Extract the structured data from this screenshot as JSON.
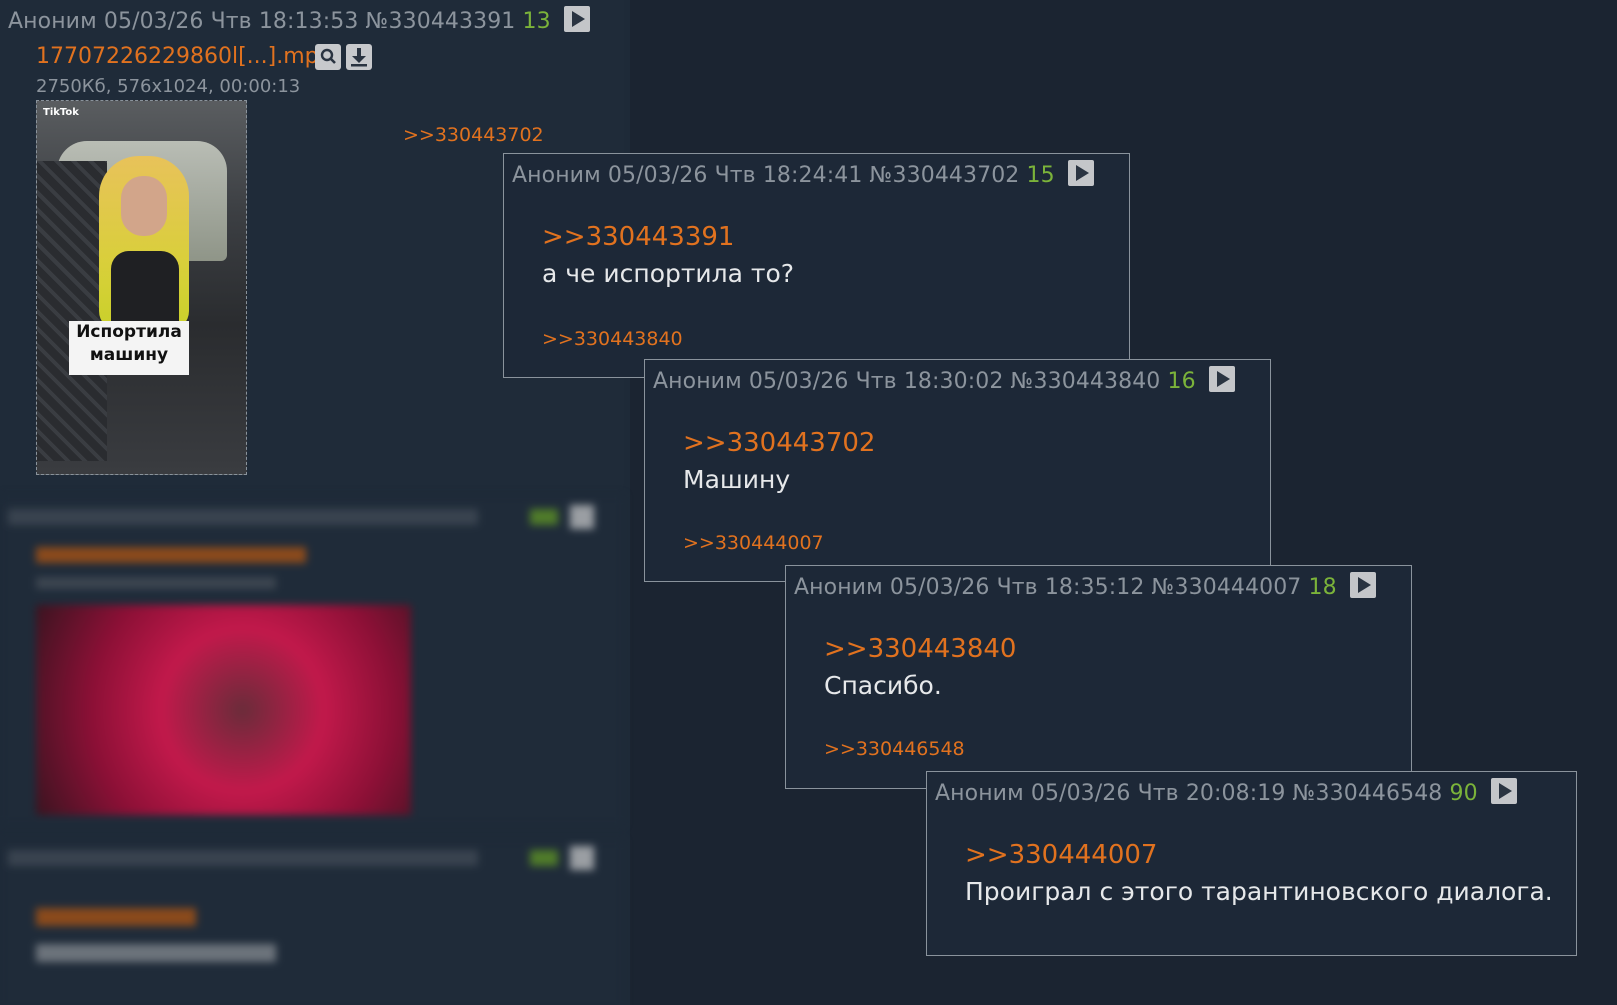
{
  "op": {
    "author": "Аноним",
    "date": "05/03/26 Чтв 18:13:53",
    "number": "№330443391",
    "count": "13",
    "file_name": "17707226229860l[...].mp4",
    "file_meta": "2750Кб, 576x1024, 00:00:13",
    "thumb_caption_line1": "Испортила",
    "thumb_caption_line2": "машину",
    "thumb_watermark": "TikTok",
    "reply": ">>330443702"
  },
  "popups": [
    {
      "author": "Аноним",
      "date": "05/03/26 Чтв 18:24:41",
      "number": "№330443702",
      "count": "15",
      "quote": ">>330443391",
      "text": "а че испортила то?",
      "reply": ">>330443840"
    },
    {
      "author": "Аноним",
      "date": "05/03/26 Чтв 18:30:02",
      "number": "№330443840",
      "count": "16",
      "quote": ">>330443702",
      "text": "Машину",
      "reply": ">>330444007"
    },
    {
      "author": "Аноним",
      "date": "05/03/26 Чтв 18:35:12",
      "number": "№330444007",
      "count": "18",
      "quote": ">>330443840",
      "text": "Спасибо.",
      "reply": ">>330446548"
    },
    {
      "author": "Аноним",
      "date": "05/03/26 Чтв 20:08:19",
      "number": "№330446548",
      "count": "90",
      "quote": ">>330444007",
      "text": "Проиграл с этого тарантиновского диалога.",
      "reply": ""
    }
  ],
  "colors": {
    "background": "#1b2431",
    "post_bg": "#1f2b39",
    "link": "#e1721f",
    "count": "#7bb33a",
    "header": "#8c949d"
  },
  "icons": [
    "play-icon",
    "search-icon",
    "download-icon"
  ]
}
